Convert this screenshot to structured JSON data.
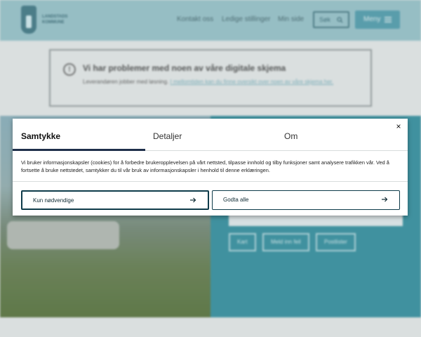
{
  "header": {
    "logo_text": "LANDSTADS KOMMUNE",
    "nav": [
      "Kontakt oss",
      "Ledige stillinger",
      "Min side"
    ],
    "search_label": "Søk",
    "menu_label": "Meny"
  },
  "alert": {
    "title": "Vi har problemer med noen av våre digitale skjema",
    "text": "Leverandøren jobber med løsning.",
    "link": "I mellomtiden kan du finne oversikt over noen av våre skjema her."
  },
  "hero": {
    "buttons": [
      "Kart",
      "Meld inn feil",
      "Postlister"
    ]
  },
  "modal": {
    "tabs": [
      "Samtykke",
      "Detaljer",
      "Om"
    ],
    "active_tab": "Samtykke",
    "close_label": "×",
    "description": "Vi bruker informasjonskapsler (cookies) for å forbedre brukeropplevelsen på vårt nettsted, tilpasse innhold og tilby funksjoner samt analysere trafikken vår. Ved å fortsette å bruke nettstedet, samtykker du til vår bruk av informasjonskapsler i henhold til denne erklæringen.",
    "buttons": {
      "necessary": "Kun nødvendige",
      "accept_all": "Godta alle"
    }
  },
  "colors": {
    "accent": "#0e3b4a",
    "tab_underline": "#1f2f4a",
    "header_bg": "#9ec8cf",
    "hero_panel": "#3e96a5"
  }
}
